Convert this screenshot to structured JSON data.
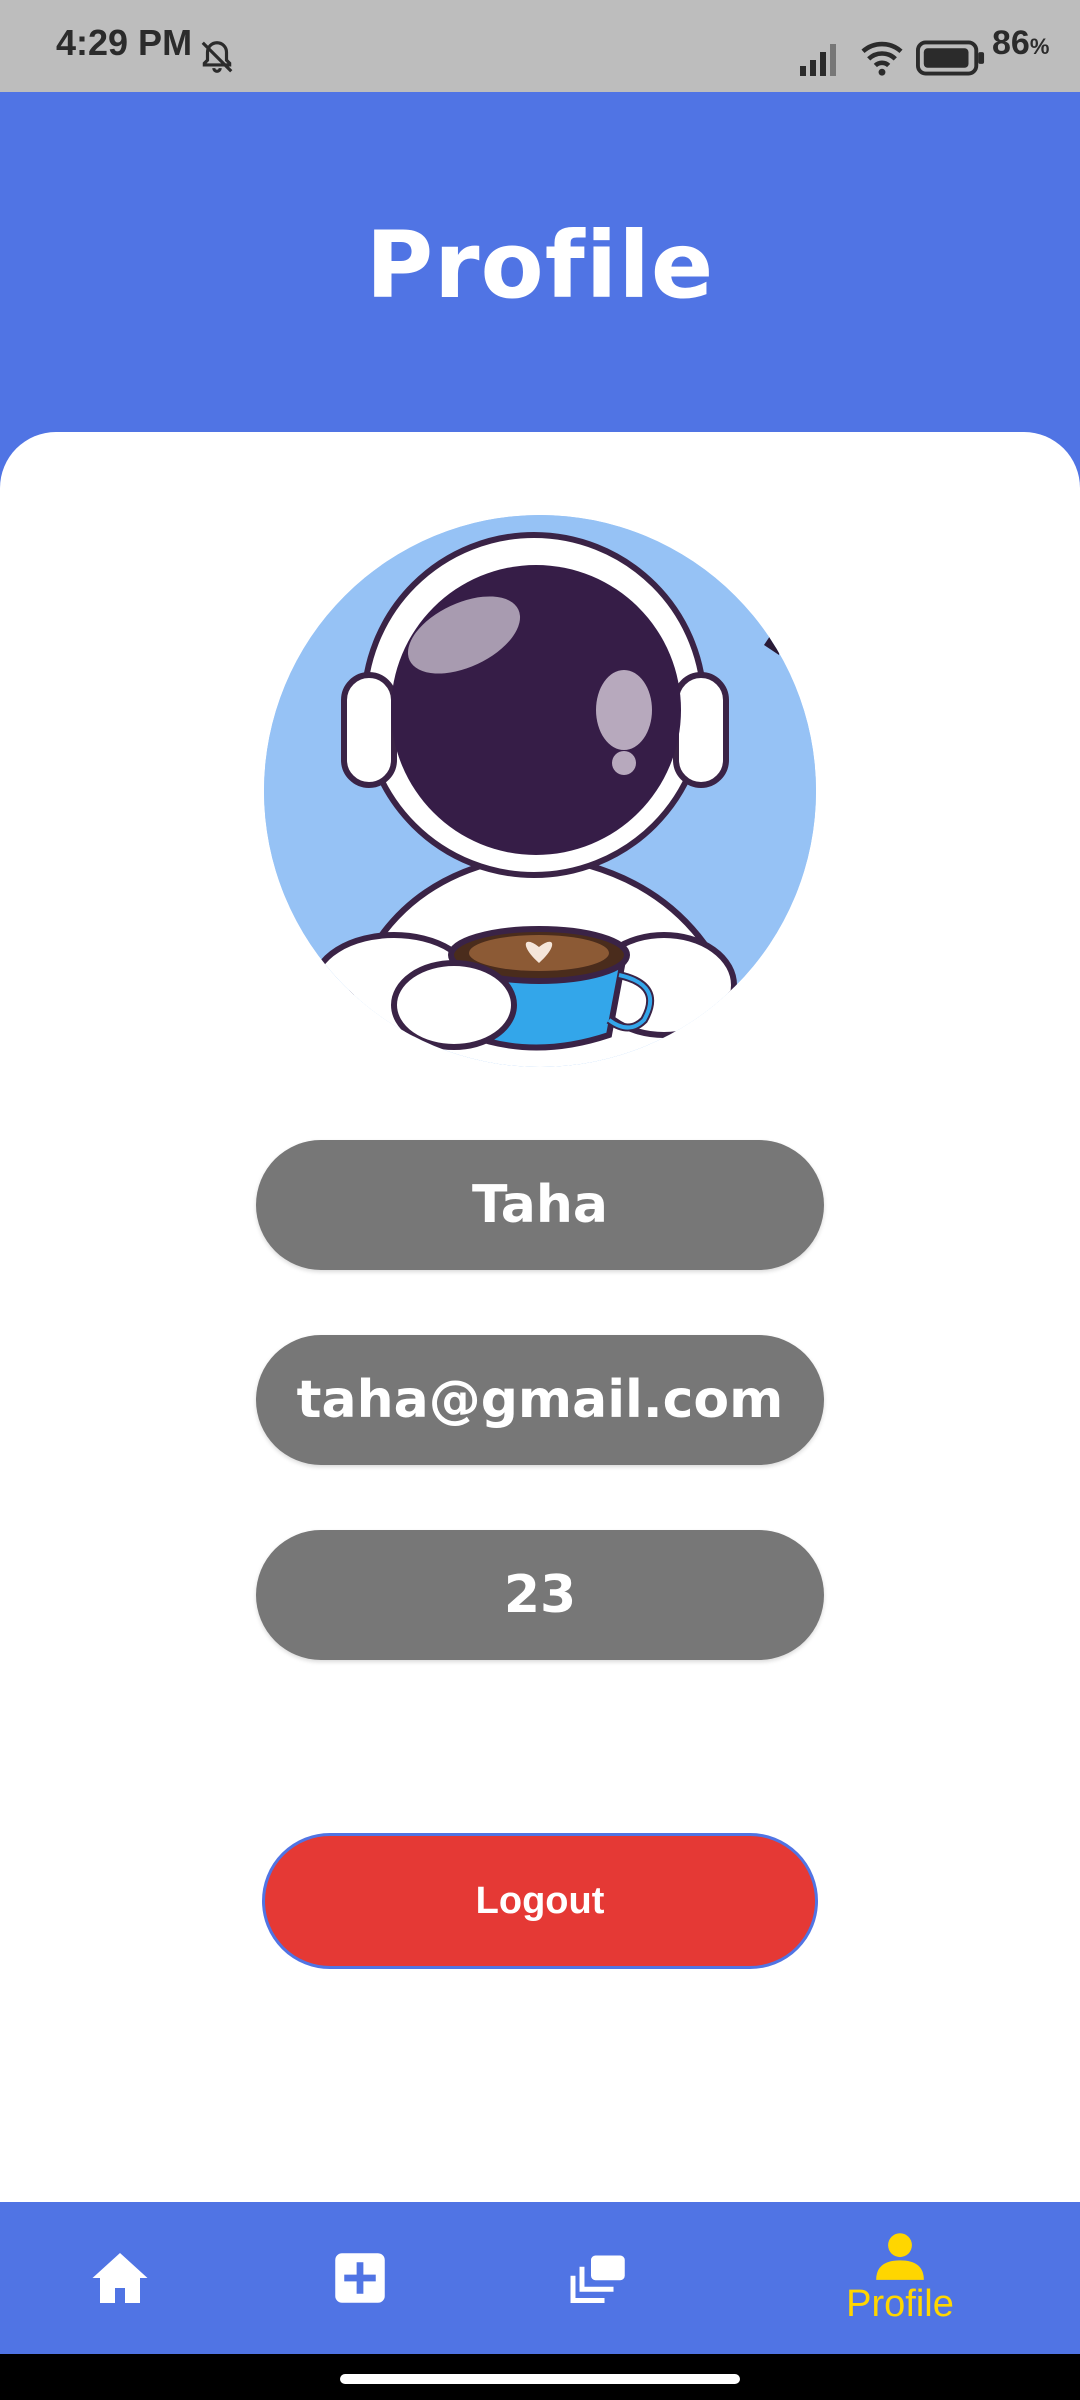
{
  "status_bar": {
    "time": "4:29 PM",
    "battery_percent": "86",
    "battery_unit": "%",
    "icons": [
      "bell-muted-icon",
      "cellular-signal-icon",
      "wifi-icon",
      "battery-icon"
    ]
  },
  "header": {
    "title": "Profile"
  },
  "profile": {
    "avatar_icon": "astronaut-avatar",
    "name": "Taha",
    "email": "taha@gmail.com",
    "age": "23"
  },
  "actions": {
    "logout_label": "Logout"
  },
  "bottom_nav": {
    "items": [
      {
        "icon": "home-icon",
        "label": ""
      },
      {
        "icon": "add-box-icon",
        "label": ""
      },
      {
        "icon": "gallery-icon",
        "label": ""
      },
      {
        "icon": "person-icon",
        "label": "Profile",
        "active": true
      }
    ]
  },
  "colors": {
    "primary": "#5074e4",
    "field_bg": "#777777",
    "logout_bg": "#e53935",
    "active_nav": "#ffd600",
    "avatar_bg": "#96c2f5"
  }
}
